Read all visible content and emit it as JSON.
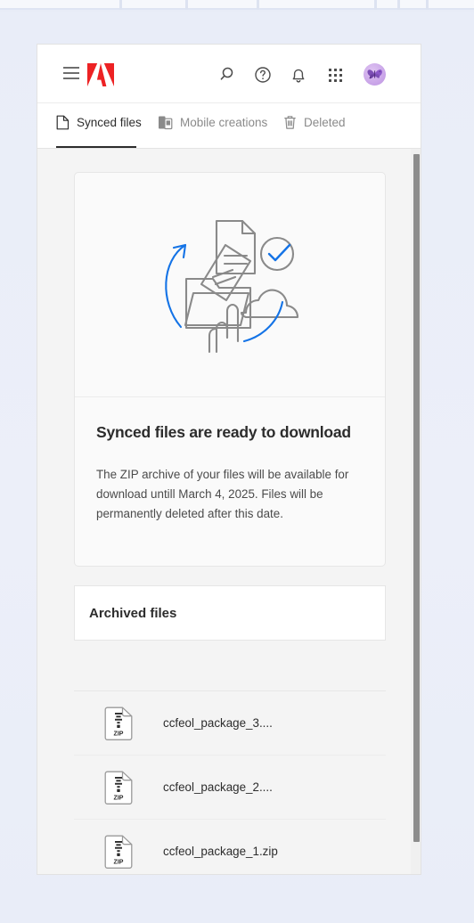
{
  "header": {
    "menu_icon": "hamburger-menu-icon",
    "logo": "adobe-logo",
    "actions": [
      {
        "name": "search-icon",
        "label": "Search"
      },
      {
        "name": "help-icon",
        "label": "Help"
      },
      {
        "name": "notifications-bell-icon",
        "label": "Notifications"
      },
      {
        "name": "app-switcher-grid-icon",
        "label": "Apps"
      }
    ],
    "avatar": {
      "name": "user-avatar",
      "image": "butterfly-avatar"
    }
  },
  "tabs": [
    {
      "label": "Synced files",
      "icon": "document-icon",
      "active": true
    },
    {
      "label": "Mobile creations",
      "icon": "mobile-device-icon",
      "active": false
    },
    {
      "label": "Deleted",
      "icon": "trash-icon",
      "active": false
    }
  ],
  "hero": {
    "illustration": "sync-files-to-cloud-illustration",
    "title": "Synced files are ready to download",
    "description": "The ZIP archive of your files will be available for download untill March 4, 2025. Files will be permanently deleted after this date."
  },
  "archived": {
    "title": "Archived files"
  },
  "files": [
    {
      "name": "ccfeol_package_3....",
      "type": "ZIP",
      "icon": "zip-file-icon"
    },
    {
      "name": "ccfeol_package_2....",
      "type": "ZIP",
      "icon": "zip-file-icon"
    },
    {
      "name": "ccfeol_package_1.zip",
      "type": "ZIP",
      "icon": "zip-file-icon"
    }
  ],
  "colors": {
    "adobe_red": "#ED2224",
    "accent_blue": "#1473E6",
    "page_background": "#e8ecf7",
    "content_background": "#f4f4f4",
    "text_primary": "#2c2c2c",
    "text_secondary": "#6e6e6e",
    "avatar_purple": "#c9a4e8"
  }
}
